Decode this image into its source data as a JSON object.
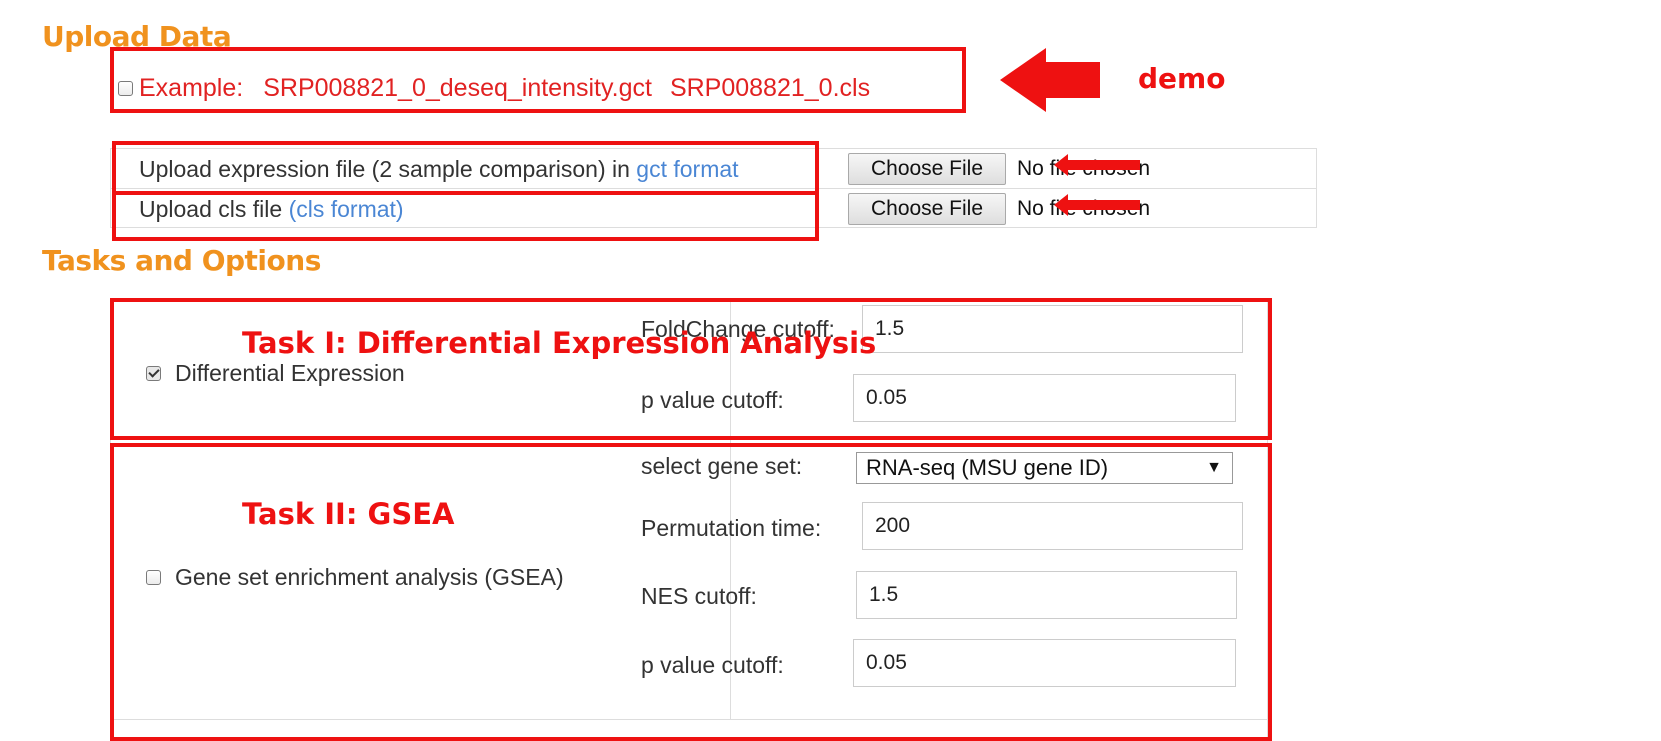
{
  "upload": {
    "title": "Upload Data",
    "example_label": "Example:",
    "example_gct_file": "SRP008821_0_deseq_intensity.gct",
    "example_cls_file": "SRP008821_0.cls",
    "rows": [
      {
        "label": "Upload expression file (2 sample comparison) in ",
        "link": "gct format",
        "button": "Choose File",
        "status": "No file chosen"
      },
      {
        "label": "Upload cls file ",
        "link": "(cls format)",
        "button": "Choose File",
        "status": "No file chosen"
      }
    ]
  },
  "tasks": {
    "title": "Tasks and Options",
    "differential": {
      "checkbox_label": "Differential Expression",
      "checked": true,
      "foldchange_label": "FoldChange cutoff:",
      "foldchange_value": "1.5",
      "pvalue_label": "p value cutoff:",
      "pvalue_value": "0.05"
    },
    "gsea": {
      "checkbox_label": "Gene set enrichment analysis (GSEA)",
      "checked": false,
      "geneset_label": "select gene set:",
      "geneset_value": "RNA-seq (MSU gene ID)",
      "permutation_label": "Permutation time:",
      "permutation_value": "200",
      "nes_label": "NES cutoff:",
      "nes_value": "1.5",
      "pvalue_label": "p value cutoff:",
      "pvalue_value": "0.05"
    }
  },
  "annotations": {
    "demo": "demo",
    "task1": "Task I: Differential Expression Analysis",
    "task2": "Task II: GSEA",
    "color": "#ee1111"
  },
  "colors": {
    "section_title": "#f0921e",
    "link": "#4a86d4",
    "example_text": "#e12222"
  }
}
